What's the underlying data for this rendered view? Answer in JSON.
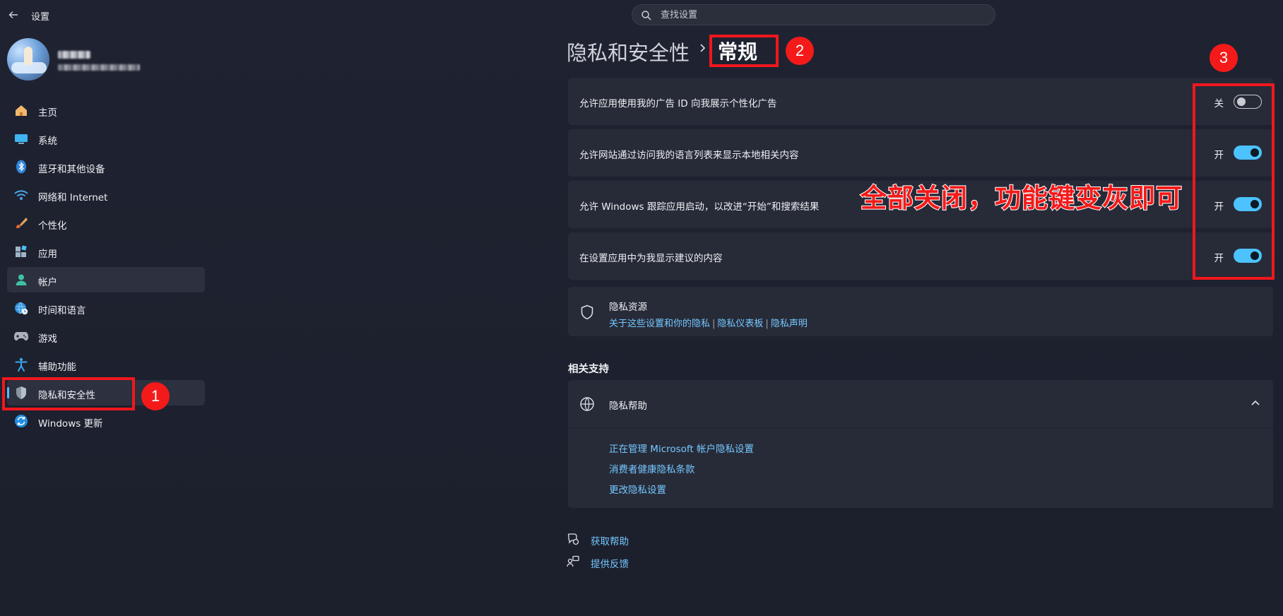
{
  "window": {
    "title": "设置"
  },
  "search": {
    "placeholder": "查找设置",
    "value": ""
  },
  "sidebar": {
    "items": [
      {
        "label": "主页",
        "icon": "home-icon"
      },
      {
        "label": "系统",
        "icon": "monitor-icon"
      },
      {
        "label": "蓝牙和其他设备",
        "icon": "bluetooth-icon"
      },
      {
        "label": "网络和 Internet",
        "icon": "wifi-icon"
      },
      {
        "label": "个性化",
        "icon": "brush-icon"
      },
      {
        "label": "应用",
        "icon": "apps-icon"
      },
      {
        "label": "帐户",
        "icon": "person-icon"
      },
      {
        "label": "时间和语言",
        "icon": "globe-clock-icon"
      },
      {
        "label": "游戏",
        "icon": "gamepad-icon"
      },
      {
        "label": "辅助功能",
        "icon": "accessibility-icon"
      },
      {
        "label": "隐私和安全性",
        "icon": "shield-icon",
        "selected": true
      },
      {
        "label": "Windows 更新",
        "icon": "update-icon"
      }
    ]
  },
  "breadcrumb": {
    "parent": "隐私和安全性",
    "current": "常规"
  },
  "settings": [
    {
      "label": "允许应用使用我的广告 ID 向我展示个性化广告",
      "state": "关",
      "on": false
    },
    {
      "label": "允许网站通过访问我的语言列表来显示本地相关内容",
      "state": "开",
      "on": true
    },
    {
      "label": "允许 Windows 跟踪应用启动，以改进“开始”和搜索结果",
      "state": "开",
      "on": true
    },
    {
      "label": "在设置应用中为我显示建议的内容",
      "state": "开",
      "on": true
    }
  ],
  "privacy_resources": {
    "title": "隐私资源",
    "links": [
      "关于这些设置和你的隐私",
      "隐私仪表板",
      "隐私声明"
    ],
    "separator": "|"
  },
  "related_support": {
    "title": "相关支持",
    "help": {
      "title": "隐私帮助",
      "links": [
        "正在管理 Microsoft 帐户隐私设置",
        "消费者健康隐私条款",
        "更改隐私设置"
      ]
    }
  },
  "footer": {
    "get_help": "获取帮助",
    "feedback": "提供反馈"
  },
  "annotations": {
    "step1": "1",
    "step2": "2",
    "step3": "3",
    "instruction": "全部关闭，功能键变灰即可",
    "color": "#f41a1a"
  },
  "colors": {
    "accent": "#4cc2ff",
    "link": "#75c8ff",
    "background": "#1d2130",
    "card": "#272b38"
  }
}
